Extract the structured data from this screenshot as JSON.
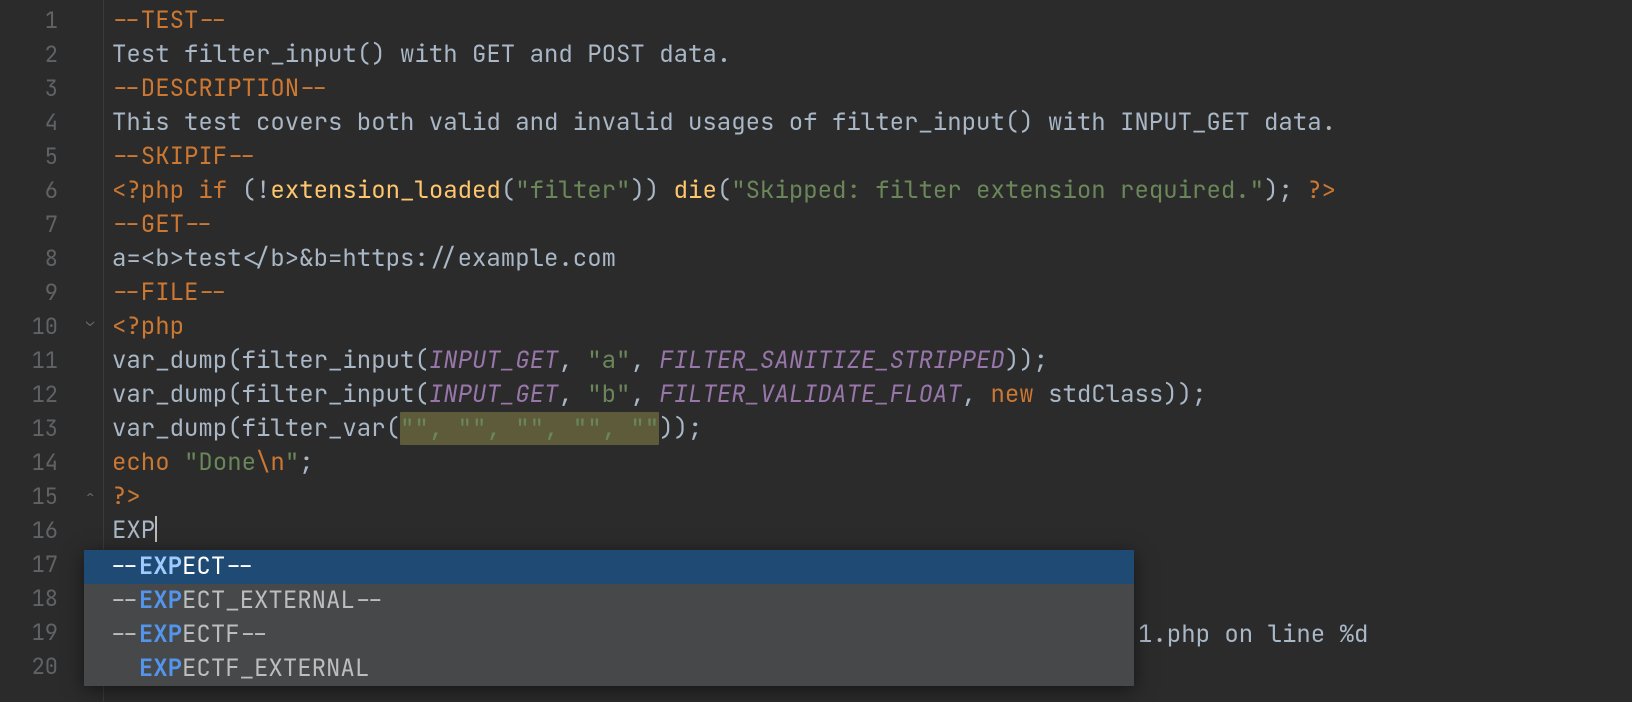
{
  "gutter": {
    "lines": [
      "1",
      "2",
      "3",
      "4",
      "5",
      "6",
      "7",
      "8",
      "9",
      "10",
      "11",
      "12",
      "13",
      "14",
      "15",
      "16",
      "17",
      "18",
      "19",
      "20"
    ]
  },
  "code": {
    "l1": "--TEST--",
    "l2": "Test filter_input() with GET and POST data.",
    "l3": "--DESCRIPTION--",
    "l4": "This test covers both valid and invalid usages of filter_input() with INPUT_GET data.",
    "l5": "--SKIPIF--",
    "l6_open": "<?php ",
    "l6_if": "if ",
    "l6_p1": "(!",
    "l6_fn": "extension_loaded",
    "l6_p2": "(",
    "l6_s1": "\"filter\"",
    "l6_p3": ")) ",
    "l6_die": "die",
    "l6_p4": "(",
    "l6_s2": "\"Skipped: filter extension required.\"",
    "l6_p5": "); ",
    "l6_close": "?>",
    "l7": "--GET--",
    "l8": "a=<b>test</b>&b=https://example.com",
    "l9": "--FILE--",
    "l10": "<?php",
    "l11_a": "var_dump(filter_input(",
    "l11_c": "INPUT_GET",
    "l11_b": ", ",
    "l11_s": "\"a\"",
    "l11_d": ", ",
    "l11_c2": "FILTER_SANITIZE_STRIPPED",
    "l11_e": "));",
    "l12_a": "var_dump(filter_input(",
    "l12_c": "INPUT_GET",
    "l12_b": ", ",
    "l12_s": "\"b\"",
    "l12_d": ", ",
    "l12_c2": "FILTER_VALIDATE_FLOAT",
    "l12_e": ", ",
    "l12_new": "new ",
    "l12_cls": "stdClass",
    "l12_f": "));",
    "l13_a": "var_dump(filter_var(",
    "l13_sel": "\"\", \"\", \"\", \"\", \"\"",
    "l13_b": "));",
    "l14_echo": "echo ",
    "l14_s": "\"Done",
    "l14_esc": "\\n",
    "l14_s2": "\"",
    "l14_p": ";",
    "l15": "?>",
    "l16": "EXP",
    "behind_popup": "1.php on line %d"
  },
  "popup": {
    "items": [
      {
        "pre": "--",
        "match": "EXP",
        "post": "ECT--"
      },
      {
        "pre": "--",
        "match": "EXP",
        "post": "ECT_EXTERNAL--"
      },
      {
        "pre": "--",
        "match": "EXP",
        "post": "ECTF--"
      },
      {
        "pre": "  ",
        "match": "EXP",
        "post": "ECTF_EXTERNAL"
      }
    ],
    "selected_index": 0
  }
}
